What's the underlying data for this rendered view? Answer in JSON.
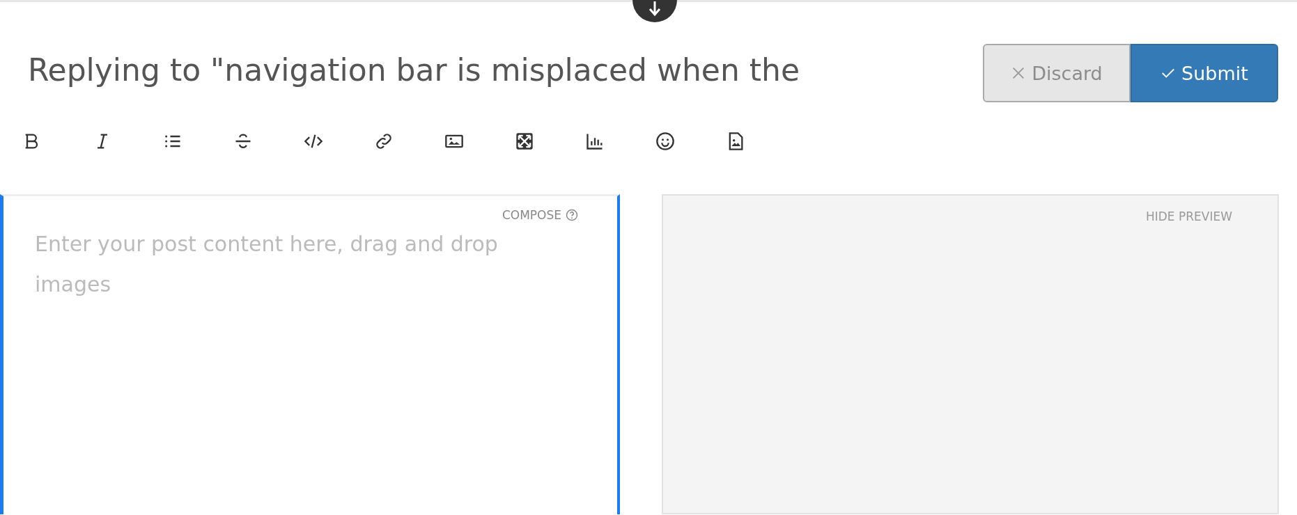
{
  "title": "Replying to \"navigation bar is misplaced when the",
  "buttons": [
    {
      "kind": "discard",
      "label": "Discard"
    },
    {
      "kind": "submit",
      "label": "Submit"
    }
  ],
  "editor": {
    "mode_label": "COMPOSE",
    "placeholder": "Enter your post content here, drag and drop images",
    "focused": true
  },
  "preview": {
    "toggle_label": "HIDE PREVIEW"
  }
}
